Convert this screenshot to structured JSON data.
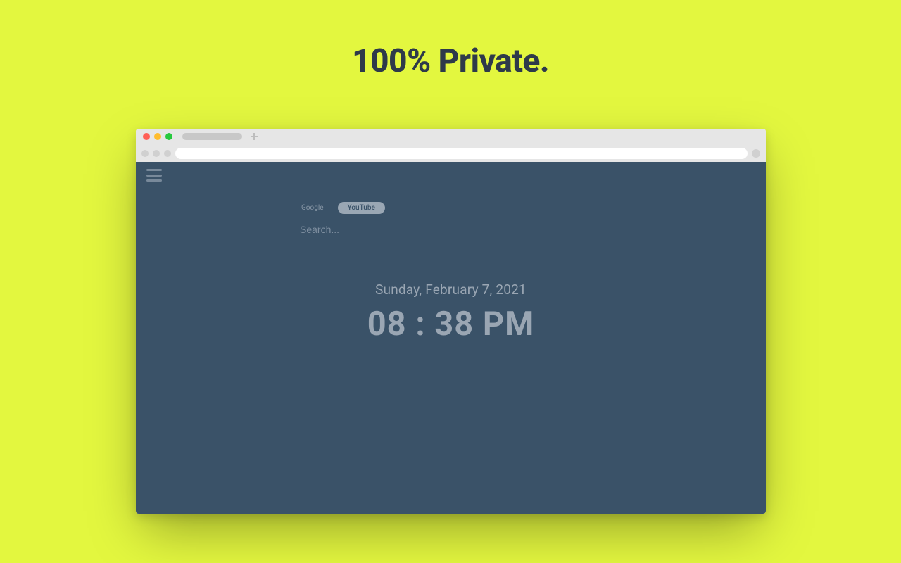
{
  "headline": "100% Private.",
  "search": {
    "engines": {
      "google": "Google",
      "youtube": "YouTube"
    },
    "placeholder": "Search..."
  },
  "clock": {
    "date": "Sunday, February 7, 2021",
    "time": "08 : 38 PM"
  },
  "colors": {
    "page_bg": "#e3f73f",
    "viewport_bg": "#3a5268",
    "muted_text": "#9aa6b3",
    "headline_text": "#2e3a4a"
  }
}
